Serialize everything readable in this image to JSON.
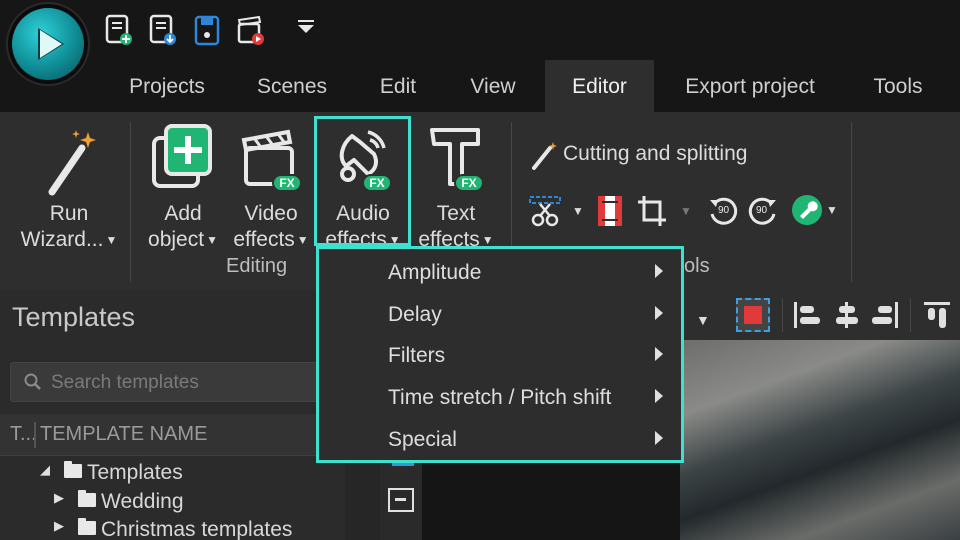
{
  "tabs": [
    {
      "label": "Projects"
    },
    {
      "label": "Scenes"
    },
    {
      "label": "Edit"
    },
    {
      "label": "View"
    },
    {
      "label": "Editor",
      "active": true
    },
    {
      "label": "Export project"
    },
    {
      "label": "Tools"
    }
  ],
  "ribbon": {
    "run_wizard": {
      "line1": "Run",
      "line2": "Wizard...",
      "icon": "magic-wand-icon"
    },
    "add_object": {
      "line1": "Add",
      "line2": "object",
      "icon": "add-object-icon"
    },
    "video_effects": {
      "line1": "Video",
      "line2": "effects",
      "icon": "video-fx-icon",
      "badge": "FX"
    },
    "audio_effects": {
      "line1": "Audio",
      "line2": "effects",
      "icon": "audio-fx-icon",
      "badge": "FX"
    },
    "text_effects": {
      "line1": "Text",
      "line2": "effects",
      "icon": "text-fx-icon",
      "badge": "FX"
    },
    "editing_group_label": "Editing",
    "cutting_label": "Cutting and splitting",
    "tools_group_label_partial": "ols",
    "rotate_ccw_label": "90",
    "rotate_cw_label": "90"
  },
  "audio_menu": {
    "items": [
      {
        "label": "Amplitude"
      },
      {
        "label": "Delay"
      },
      {
        "label": "Filters"
      },
      {
        "label": "Time stretch / Pitch shift"
      },
      {
        "label": "Special"
      }
    ]
  },
  "templates": {
    "title": "Templates",
    "search_placeholder": "Search templates",
    "col_t": "T...",
    "col_name": "TEMPLATE NAME",
    "tree": [
      {
        "label": "Templates"
      },
      {
        "label": "Wedding"
      },
      {
        "label": "Christmas templates"
      }
    ]
  },
  "colors": {
    "accent": "#3fe0d0",
    "fx_badge": "#21b573",
    "background": "#2e2e2e"
  }
}
